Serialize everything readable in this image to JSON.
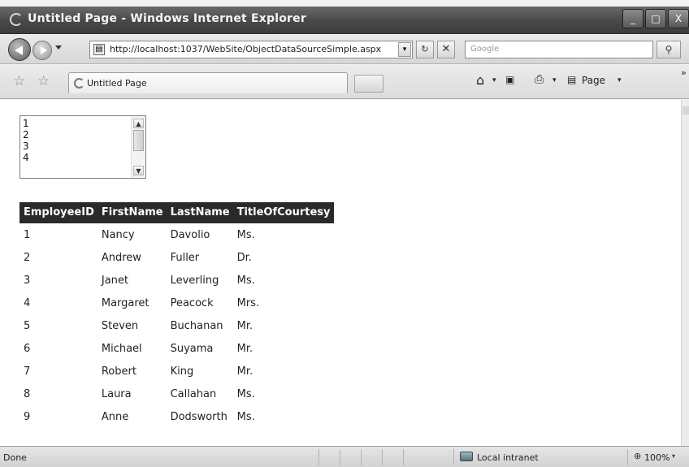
{
  "window": {
    "title": "Untitled Page - Windows Internet Explorer",
    "controls": {
      "minimize": "_",
      "maximize": "□",
      "close": "X"
    }
  },
  "address_bar": {
    "url": "http://localhost:1037/WebSite/ObjectDataSourceSimple.aspx",
    "search_placeholder": "Google"
  },
  "tab": {
    "label": "Untitled Page"
  },
  "command_bar": {
    "page_label": "Page"
  },
  "icons": {
    "back": "back-arrow-icon",
    "forward": "forward-arrow-icon",
    "refresh": "refresh-icon",
    "stop": "stop-icon",
    "search": "search-icon",
    "favorites": "favorites-star-icon",
    "add_favorites": "add-favorites-icon",
    "home": "home-icon",
    "feeds": "feeds-icon",
    "print": "print-icon",
    "page": "page-icon"
  },
  "glyphs": {
    "dropdown": "▾",
    "refresh": "↻",
    "stop": "✕",
    "search": "⚲",
    "star": "☆",
    "add_star": "☆",
    "home": "⌂",
    "feed": "▣",
    "print": "⎙",
    "page": "▤",
    "more": "»",
    "lb_up": "▲",
    "lb_down": "▼",
    "zoom": "⊕"
  },
  "listbox": {
    "items": [
      "1",
      "2",
      "3",
      "4"
    ]
  },
  "employee_grid": {
    "columns": [
      "EmployeeID",
      "FirstName",
      "LastName",
      "TitleOfCourtesy"
    ],
    "rows": [
      [
        "1",
        "Nancy",
        "Davolio",
        "Ms."
      ],
      [
        "2",
        "Andrew",
        "Fuller",
        "Dr."
      ],
      [
        "3",
        "Janet",
        "Leverling",
        "Ms."
      ],
      [
        "4",
        "Margaret",
        "Peacock",
        "Mrs."
      ],
      [
        "5",
        "Steven",
        "Buchanan",
        "Mr."
      ],
      [
        "6",
        "Michael",
        "Suyama",
        "Mr."
      ],
      [
        "7",
        "Robert",
        "King",
        "Mr."
      ],
      [
        "8",
        "Laura",
        "Callahan",
        "Ms."
      ],
      [
        "9",
        "Anne",
        "Dodsworth",
        "Ms."
      ]
    ]
  },
  "status_bar": {
    "status": "Done",
    "zone": "Local intranet",
    "zoom": "100%"
  },
  "colors": {
    "grid_header_bg": "#2a2a2a",
    "grid_header_text": "#ffffff",
    "titlebar": "#4a4a4a"
  }
}
